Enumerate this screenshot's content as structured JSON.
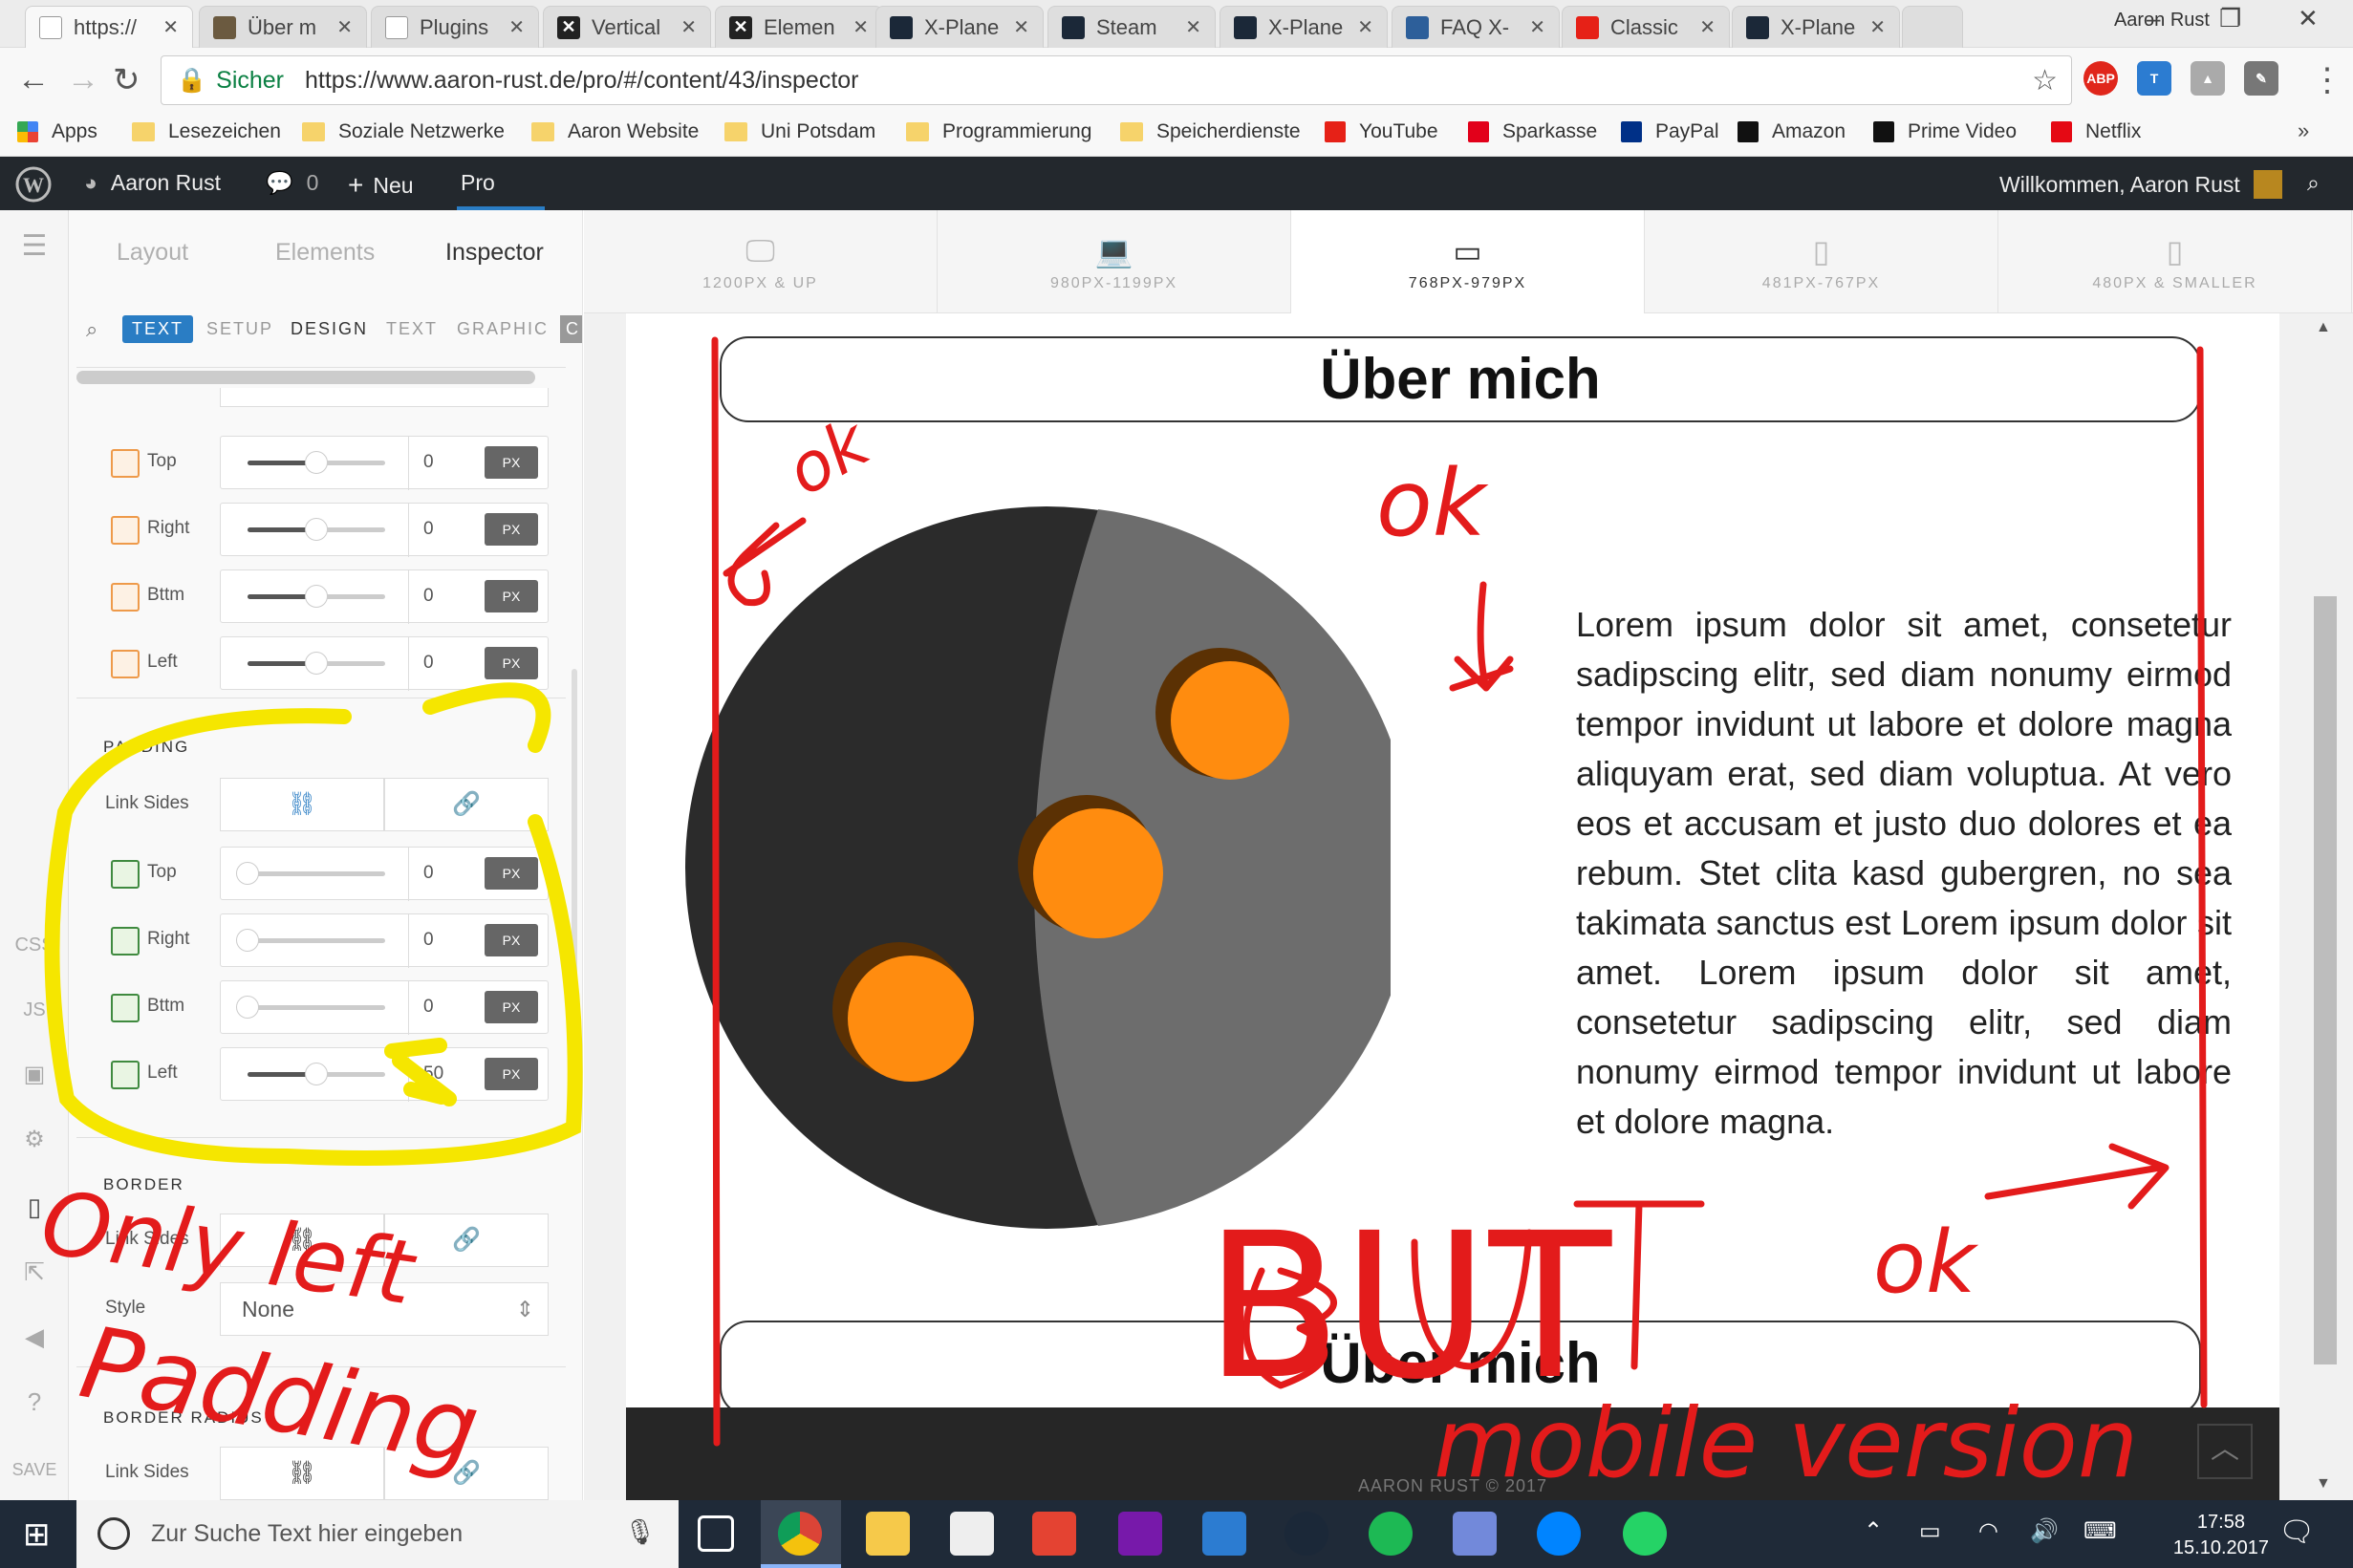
{
  "browser": {
    "tabs": [
      {
        "label": "https://",
        "icon": "page-icon",
        "color": "#ffffff",
        "active": true
      },
      {
        "label": "Über m",
        "icon": "xplane-icon",
        "color": "#6b5a40"
      },
      {
        "label": "Plugins",
        "icon": "page-icon",
        "color": "#ffffff"
      },
      {
        "label": "Vertical",
        "icon": "x-icon",
        "color": "#222222"
      },
      {
        "label": "Elemen",
        "icon": "x-icon",
        "color": "#222222"
      },
      {
        "label": "X-Plane",
        "icon": "steam-icon",
        "color": "#1b2838"
      },
      {
        "label": "Steam",
        "icon": "steam-icon",
        "color": "#1b2838"
      },
      {
        "label": "X-Plane",
        "icon": "steam-icon",
        "color": "#1b2838"
      },
      {
        "label": "FAQ X-",
        "icon": "xplane-icon",
        "color": "#2d5f9a"
      },
      {
        "label": "Classic",
        "icon": "youtube-icon",
        "color": "#e62117"
      },
      {
        "label": "X-Plane",
        "icon": "steam-icon",
        "color": "#1b2838"
      }
    ],
    "profile_name": "Aaron Rust",
    "secure_label": "Sicher",
    "url": "https://www.aaron-rust.de/pro/#/content/43/inspector",
    "bookmarks": [
      {
        "label": "Apps",
        "icon": "apps-icon"
      },
      {
        "label": "Lesezeichen",
        "icon": "folder-icon"
      },
      {
        "label": "Soziale Netzwerke",
        "icon": "folder-icon"
      },
      {
        "label": "Aaron Website",
        "icon": "folder-icon"
      },
      {
        "label": "Uni Potsdam",
        "icon": "folder-icon"
      },
      {
        "label": "Programmierung",
        "icon": "folder-icon"
      },
      {
        "label": "Speicherdienste",
        "icon": "folder-icon"
      },
      {
        "label": "YouTube",
        "icon": "youtube-icon"
      },
      {
        "label": "Sparkasse",
        "icon": "sparkasse-icon"
      },
      {
        "label": "PayPal",
        "icon": "paypal-icon"
      },
      {
        "label": "Amazon",
        "icon": "amazon-icon"
      },
      {
        "label": "Prime Video",
        "icon": "amazon-icon"
      },
      {
        "label": "Netflix",
        "icon": "netflix-icon"
      }
    ],
    "more_bookmarks": "»"
  },
  "wp_admin": {
    "site_name": "Aaron Rust",
    "comments": "0",
    "new_label": "Neu",
    "pro_label": "Pro",
    "welcome": "Willkommen, Aaron Rust"
  },
  "builder": {
    "left_strip": {
      "css": "CSS",
      "js": "JS",
      "save": "SAVE"
    },
    "inspector_tabs": [
      "Layout",
      "Elements",
      "Inspector"
    ],
    "sub_tabs": [
      "TEXT",
      "SETUP",
      "DESIGN",
      "TEXT",
      "GRAPHIC",
      "C"
    ],
    "margin_rows": [
      {
        "label": "Top",
        "value": "0",
        "unit": "PX",
        "slider": 0.5
      },
      {
        "label": "Right",
        "value": "0",
        "unit": "PX",
        "slider": 0.5
      },
      {
        "label": "Bttm",
        "value": "0",
        "unit": "PX",
        "slider": 0.5
      },
      {
        "label": "Left",
        "value": "0",
        "unit": "PX",
        "slider": 0.5
      }
    ],
    "padding": {
      "title": "PADDING",
      "link_sides_label": "Link Sides",
      "rows": [
        {
          "label": "Top",
          "value": "0",
          "unit": "PX",
          "slider": 0.0
        },
        {
          "label": "Right",
          "value": "0",
          "unit": "PX",
          "slider": 0.0
        },
        {
          "label": "Bttm",
          "value": "0",
          "unit": "PX",
          "slider": 0.0
        },
        {
          "label": "Left",
          "value": "50",
          "unit": "PX",
          "slider": 0.5
        }
      ]
    },
    "border": {
      "title": "BORDER",
      "link_sides_label": "Link Sides",
      "style_label": "Style",
      "style_value": "None"
    },
    "border_radius": {
      "title": "BORDER RADIUS",
      "link_sides_label": "Link Sides"
    },
    "breakpoints": [
      {
        "label": "1200PX & UP",
        "icon": "desktop-icon"
      },
      {
        "label": "980PX-1199PX",
        "icon": "laptop-icon"
      },
      {
        "label": "768PX-979PX",
        "icon": "tablet-landscape-icon",
        "active": true
      },
      {
        "label": "481PX-767PX",
        "icon": "tablet-icon"
      },
      {
        "label": "480PX & SMALLER",
        "icon": "phone-icon"
      }
    ]
  },
  "preview": {
    "heading": "Über mich",
    "lorem": "Lorem ipsum dolor sit amet, consetetur sadipscing elitr, sed diam nonumy eirmod tempor invidunt ut labore et dolore magna aliquyam erat, sed diam voluptua. At vero eos et accusam et justo duo dolores et ea rebum. Stet clita kasd gubergren, no sea takimata sanctus est Lorem ipsum dolor sit amet. Lorem ipsum dolor sit amet, consetetur sadipscing elitr, sed diam nonumy eirmod tempor invidunt ut labore et dolore magna.",
    "footer_text": "AARON RUST © 2017",
    "colors": {
      "dark_moon": "#2b2b2b",
      "light_moon": "#6d6d6d",
      "craters": "#ff8c0f"
    }
  },
  "annotations": {
    "ok_1": "ok",
    "ok_2": "ok",
    "ok_3": "ok",
    "only_left": "Only left",
    "padding": "Padding",
    "but": "BUT",
    "mobile_version": "mobile version",
    "colors": {
      "red": "#e31b1b",
      "yellow": "#f5e600"
    }
  },
  "taskbar": {
    "search_placeholder": "Zur Suche Text hier eingeben",
    "time": "17:58",
    "date": "15.10.2017"
  }
}
